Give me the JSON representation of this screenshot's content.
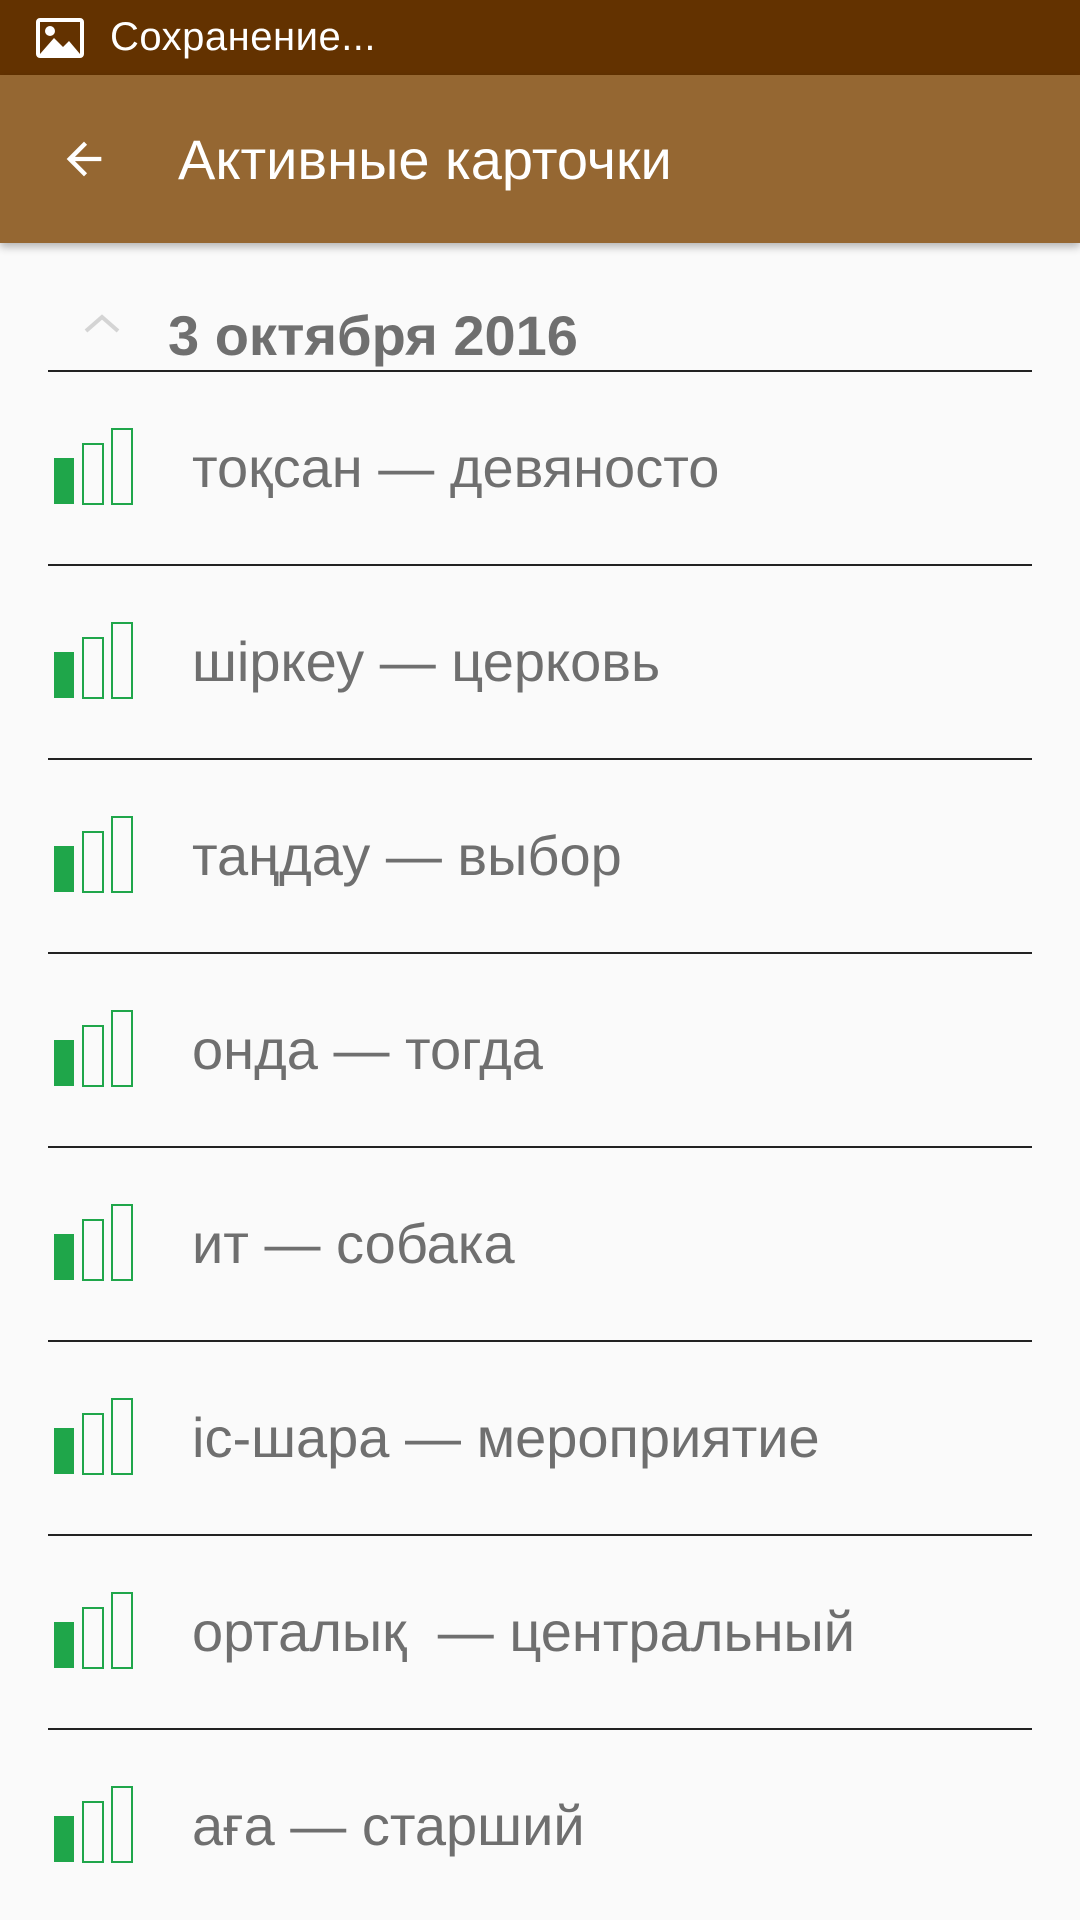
{
  "status_bar": {
    "icon": "image-icon",
    "text": "Сохранение..."
  },
  "app_bar": {
    "back_icon": "arrow-back-icon",
    "title": "Активные карточки",
    "background_color": "#956732",
    "status_color": "#633200"
  },
  "section": {
    "collapse_icon": "chevron-up-icon",
    "date": "3 октября 2016"
  },
  "level_indicator": {
    "icon": "card-level-icon",
    "filled_bars": 1,
    "total_bars": 3,
    "color": "#1fa64a"
  },
  "cards": [
    {
      "text": "тоқсан — девяносто"
    },
    {
      "text": "шіркеу — церковь"
    },
    {
      "text": "таңдау — выбор"
    },
    {
      "text": "онда — тогда"
    },
    {
      "text": "ит — собака"
    },
    {
      "text": "іс-шара — мероприятие"
    },
    {
      "text": "орталық  — центральный"
    },
    {
      "text": "аға — старший"
    }
  ]
}
